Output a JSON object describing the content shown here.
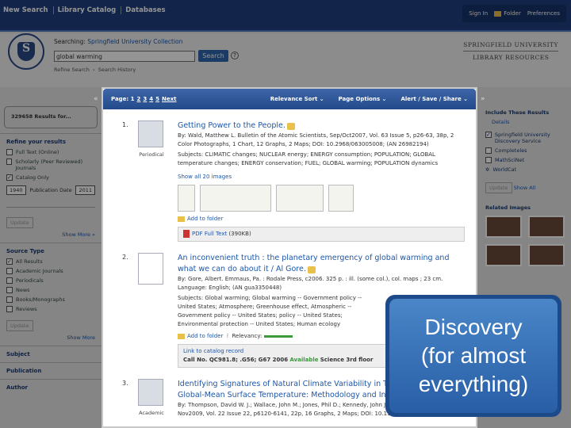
{
  "topnav": {
    "items": [
      "New Search",
      "Library Catalog",
      "Databases"
    ],
    "right": [
      "Sign In",
      "Folder",
      "Preferences"
    ]
  },
  "header": {
    "searching_label": "Searching:",
    "collection": "Springfield University Collection",
    "query": "global warming",
    "search_button": "Search",
    "help": "?",
    "links": [
      "Refine Search",
      "Search History"
    ],
    "brand_line1": "SPRINGFIELD UNIVERSITY",
    "brand_line2": "LIBRARY RESOURCES",
    "seal_letter": "S"
  },
  "left": {
    "results": "329658 Results for...",
    "refine_title": "Refine your results",
    "limiters": [
      {
        "label": "Full Text (Online)",
        "checked": false
      },
      {
        "label": "Scholarly (Peer Reviewed) Journals",
        "checked": false
      },
      {
        "label": "Catalog Only",
        "checked": true
      }
    ],
    "date_from": "1940",
    "date_label": "Publication Date",
    "date_to": "2011",
    "update": "Update",
    "show_more": "Show More »",
    "source_title": "Source Type",
    "sources": [
      {
        "label": "All Results",
        "checked": true
      },
      {
        "label": "Academic Journals",
        "checked": false
      },
      {
        "label": "Periodicals",
        "checked": false
      },
      {
        "label": "News",
        "checked": false
      },
      {
        "label": "Books/Monographs",
        "checked": false
      },
      {
        "label": "Reviews",
        "checked": false
      }
    ],
    "update2": "Update",
    "show_more2": "Show More",
    "facets": [
      "Subject",
      "Publication",
      "Author"
    ]
  },
  "toolbar": {
    "page_label": "Page: 1",
    "pages": [
      "2",
      "3",
      "4",
      "5",
      "Next"
    ],
    "sort": "Relevance Sort ⌄",
    "options": "Page Options ⌄",
    "share": "Alert / Save / Share ⌄"
  },
  "results": [
    {
      "num": "1.",
      "type": "Periodical",
      "title": "Getting Power to the People.",
      "meta": "By: Wald, Matthew L. Bulletin of the Atomic Scientists, Sep/Oct2007, Vol. 63 Issue 5, p26-63, 38p, 2 Color Photographs, 1 Chart, 12 Graphs, 2 Maps; DOI: 10.2968/063005008; (AN 26982194)",
      "subjects": "Subjects: CLIMATIC changes; NUCLEAR energy; ENERGY consumption; POPULATION; GLOBAL temperature changes; ENERGY conservation; FUEL; GLOBAL warming; POPULATION dynamics",
      "show_images": "Show all 20 images",
      "add_folder": "Add to folder",
      "fulltext": "PDF Full Text",
      "size": "(390KB)"
    },
    {
      "num": "2.",
      "title": "An inconvenient truth : the planetary emergency of global warming and what we can do about it / Al Gore.",
      "meta": "By: Gore, Albert. Emmaus, Pa. : Rodale Press, c2006. 325 p. : ill. (some col.), col. maps ; 23 cm. Language: English; (AN gua3350448)",
      "subjects": "Subjects: Global warming; Global warming -- Government policy -- United States; Atmosphere; Greenhouse effect, Atmospheric -- Government policy -- United States; policy -- United States; Environmental protection -- United States; Human ecology",
      "add_folder": "Add to folder",
      "relevancy": "Relevancy:",
      "catalog_link": "Link to catalog record",
      "call_no": "Call No. QC981.8; .G56; G67 2006",
      "available": "Available",
      "location": "Science 3rd floor"
    },
    {
      "num": "3.",
      "type": "Academic",
      "title": "Identifying Signatures of Natural Climate Variability in Time Series of Global-Mean Surface Temperature: Methodology and Insights.",
      "meta": "By: Thompson, David W. J.; Wallace, John M.; Jones, Phil D.; Kennedy, John J. Journal of Climate, Nov2009, Vol. 22 Issue 22, p6120-6141, 22p, 16 Graphs, 2 Maps; DOI: 10.1175/2009JCLI3089.1; (AN"
    }
  ],
  "right": {
    "include_title": "Include These Results",
    "details": "Details",
    "sources": [
      {
        "label": "Springfield University Discovery Service",
        "checked": true
      },
      {
        "label": "Completeles",
        "checked": false
      },
      {
        "label": "MathSciNet",
        "checked": false
      }
    ],
    "loading": "WorldCat",
    "update": "Update",
    "show_all": "Show All",
    "related_images": "Related Images"
  },
  "callout": {
    "text": "Discovery\n(for almost\neverything)"
  }
}
